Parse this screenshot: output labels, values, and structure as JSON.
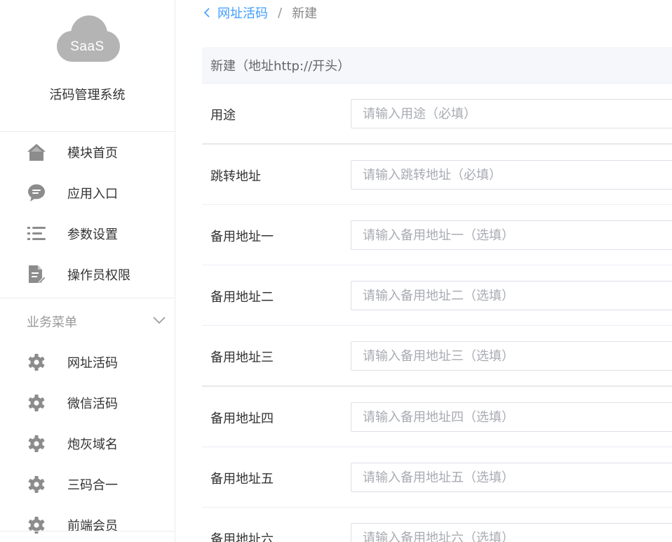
{
  "sidebar": {
    "logo_text": "SaaS",
    "app_title": "活码管理系统",
    "top_items": [
      {
        "label": "模块首页",
        "icon": "home-icon"
      },
      {
        "label": "应用入口",
        "icon": "chat-icon"
      },
      {
        "label": "参数设置",
        "icon": "list-settings-icon"
      },
      {
        "label": "操作员权限",
        "icon": "document-edit-icon"
      }
    ],
    "group": {
      "label": "业务菜单",
      "icon": "chevron-down-icon",
      "items": [
        {
          "label": "网址活码",
          "icon": "gear-icon"
        },
        {
          "label": "微信活码",
          "icon": "gear-icon"
        },
        {
          "label": "炮灰域名",
          "icon": "gear-icon"
        },
        {
          "label": "三码合一",
          "icon": "gear-icon"
        },
        {
          "label": "前端会员",
          "icon": "gear-icon"
        }
      ]
    }
  },
  "breadcrumb": {
    "parent": "网址活码",
    "separator": "/",
    "current": "新建"
  },
  "form": {
    "header": "新建（地址http://开头）",
    "fields": [
      {
        "label": "用途",
        "value": "",
        "placeholder": "请输入用途（必填）"
      },
      {
        "label": "跳转地址",
        "value": "",
        "placeholder": "请输入跳转地址（必填）"
      },
      {
        "label": "备用地址一",
        "value": "",
        "placeholder": "请输入备用地址一（选填）"
      },
      {
        "label": "备用地址二",
        "value": "",
        "placeholder": "请输入备用地址二（选填）"
      },
      {
        "label": "备用地址三",
        "value": "",
        "placeholder": "请输入备用地址三（选填）"
      },
      {
        "label": "备用地址四",
        "value": "",
        "placeholder": "请输入备用地址四（选填）"
      },
      {
        "label": "备用地址五",
        "value": "",
        "placeholder": "请输入备用地址五（选填）"
      },
      {
        "label": "备用地址六",
        "value": "",
        "placeholder": "请输入备用地址六（选填）"
      }
    ]
  },
  "colors": {
    "accent": "#409eff",
    "icon_gray": "#8c8c8c",
    "logo_gray": "#b4b4b4"
  }
}
